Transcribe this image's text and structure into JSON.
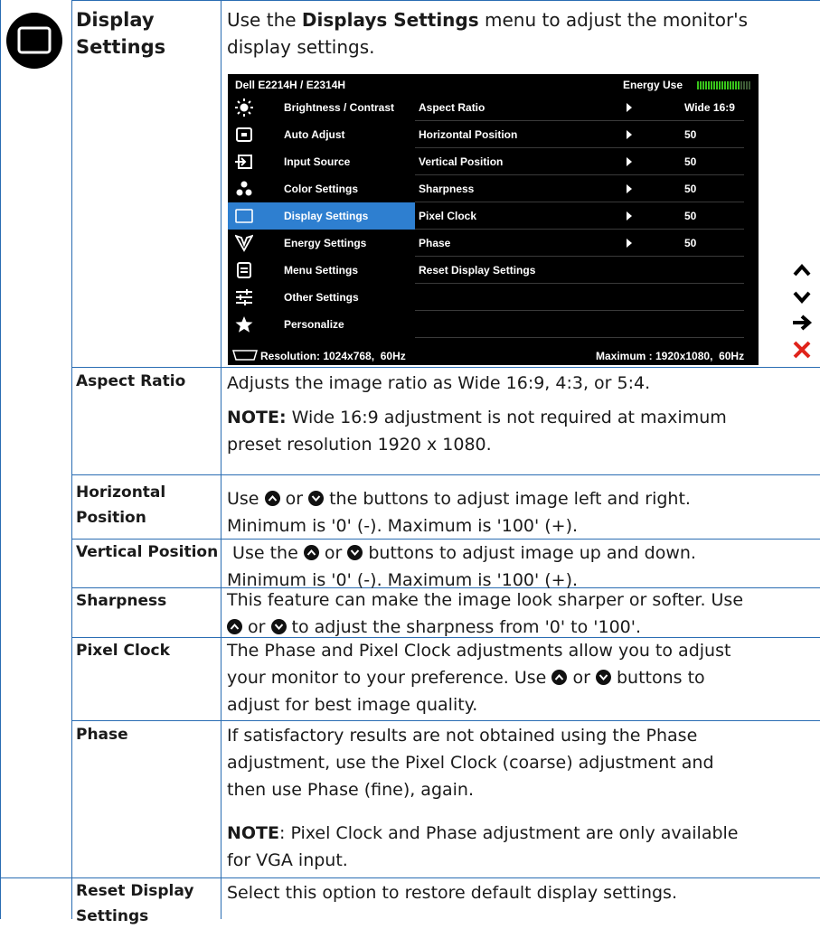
{
  "header": {
    "title_line1": "Display",
    "title_line2": "Settings",
    "intro_prefix": "Use the ",
    "intro_bold": "Displays Settings",
    "intro_suffix": " menu to adjust the monitor's",
    "intro_line2": "display settings."
  },
  "osd": {
    "model": "Dell E2214H / E2314H",
    "energy_label": "Energy Use",
    "energy_level": 0.8,
    "menu": [
      {
        "label": "Brightness / Contrast",
        "icon": "brightness-icon"
      },
      {
        "label": "Auto Adjust",
        "icon": "auto-adjust-icon"
      },
      {
        "label": "Input Source",
        "icon": "input-source-icon"
      },
      {
        "label": "Color Settings",
        "icon": "color-settings-icon"
      },
      {
        "label": "Display Settings",
        "icon": "display-icon",
        "selected": true
      },
      {
        "label": "Energy Settings",
        "icon": "energy-icon"
      },
      {
        "label": "Menu Settings",
        "icon": "menu-settings-icon"
      },
      {
        "label": "Other Settings",
        "icon": "other-settings-icon"
      },
      {
        "label": "Personalize",
        "icon": "star-icon"
      }
    ],
    "submenu": [
      {
        "name": "Aspect Ratio",
        "value": "Wide 16:9"
      },
      {
        "name": "Horizontal Position",
        "value": "50"
      },
      {
        "name": "Vertical Position",
        "value": "50"
      },
      {
        "name": "Sharpness",
        "value": "50"
      },
      {
        "name": "Pixel Clock",
        "value": "50"
      },
      {
        "name": "Phase",
        "value": "50"
      },
      {
        "name": "Reset Display Settings",
        "value": ""
      }
    ],
    "resolution": "Resolution: 1024x768,  60Hz",
    "maximum": "Maximum : 1920x1080,  60Hz",
    "side_buttons": [
      "up-arrow-icon",
      "down-arrow-icon",
      "right-arrow-icon",
      "close-icon"
    ],
    "colors": {
      "selected": "#2e7fd0",
      "energy": "#38c51b",
      "close": "#e0231b"
    }
  },
  "rows": {
    "aspect": {
      "label": "Aspect Ratio",
      "desc": "Adjusts the image ratio as Wide 16:9, 4:3, or 5:4.",
      "note_bold": "NOTE:",
      "note_line1": " Wide 16:9 adjustment is not required at maximum",
      "note_line2": "preset resolution  1920 x 1080."
    },
    "hpos": {
      "label_line1": "Horizontal",
      "label_line2": "Position",
      "d1_a": "Use ",
      "d1_b": " or ",
      "d1_c": " the buttons to adjust image left and right.",
      "d2": "Minimum is '0' (-). Maximum is '100' (+)."
    },
    "vpos": {
      "label": "Vertical Position",
      "d1_a": " Use the ",
      "d1_b": " or ",
      "d1_c": " buttons to adjust image up and down.",
      "d2": "Minimum is '0' (-). Maximum is '100' (+)."
    },
    "sharp": {
      "label": "Sharpness",
      "d1": "This feature can make the image look sharper or softer. Use",
      "d2_b": " or ",
      "d2_c": " to adjust the sharpness from '0' to '100'."
    },
    "pclock": {
      "label": "Pixel Clock",
      "d1": "The Phase and Pixel Clock adjustments allow you to adjust",
      "d2_a": "your monitor to your preference. Use ",
      "d2_b": " or ",
      "d2_c": " buttons to",
      "d3": "adjust for best image quality."
    },
    "phase": {
      "label": "Phase",
      "d1": "If satisfactory results are not obtained using the Phase",
      "d2": "adjustment, use the Pixel Clock (coarse) adjustment and",
      "d3": "then use Phase (fine), again.",
      "note_bold": "NOTE",
      "note_line1": ": Pixel Clock and Phase adjustment are only available",
      "note_line2": "for VGA input."
    },
    "reset": {
      "label_line1": "Reset Display",
      "label_line2": "Settings",
      "desc": "Select this option to restore default display settings."
    }
  }
}
